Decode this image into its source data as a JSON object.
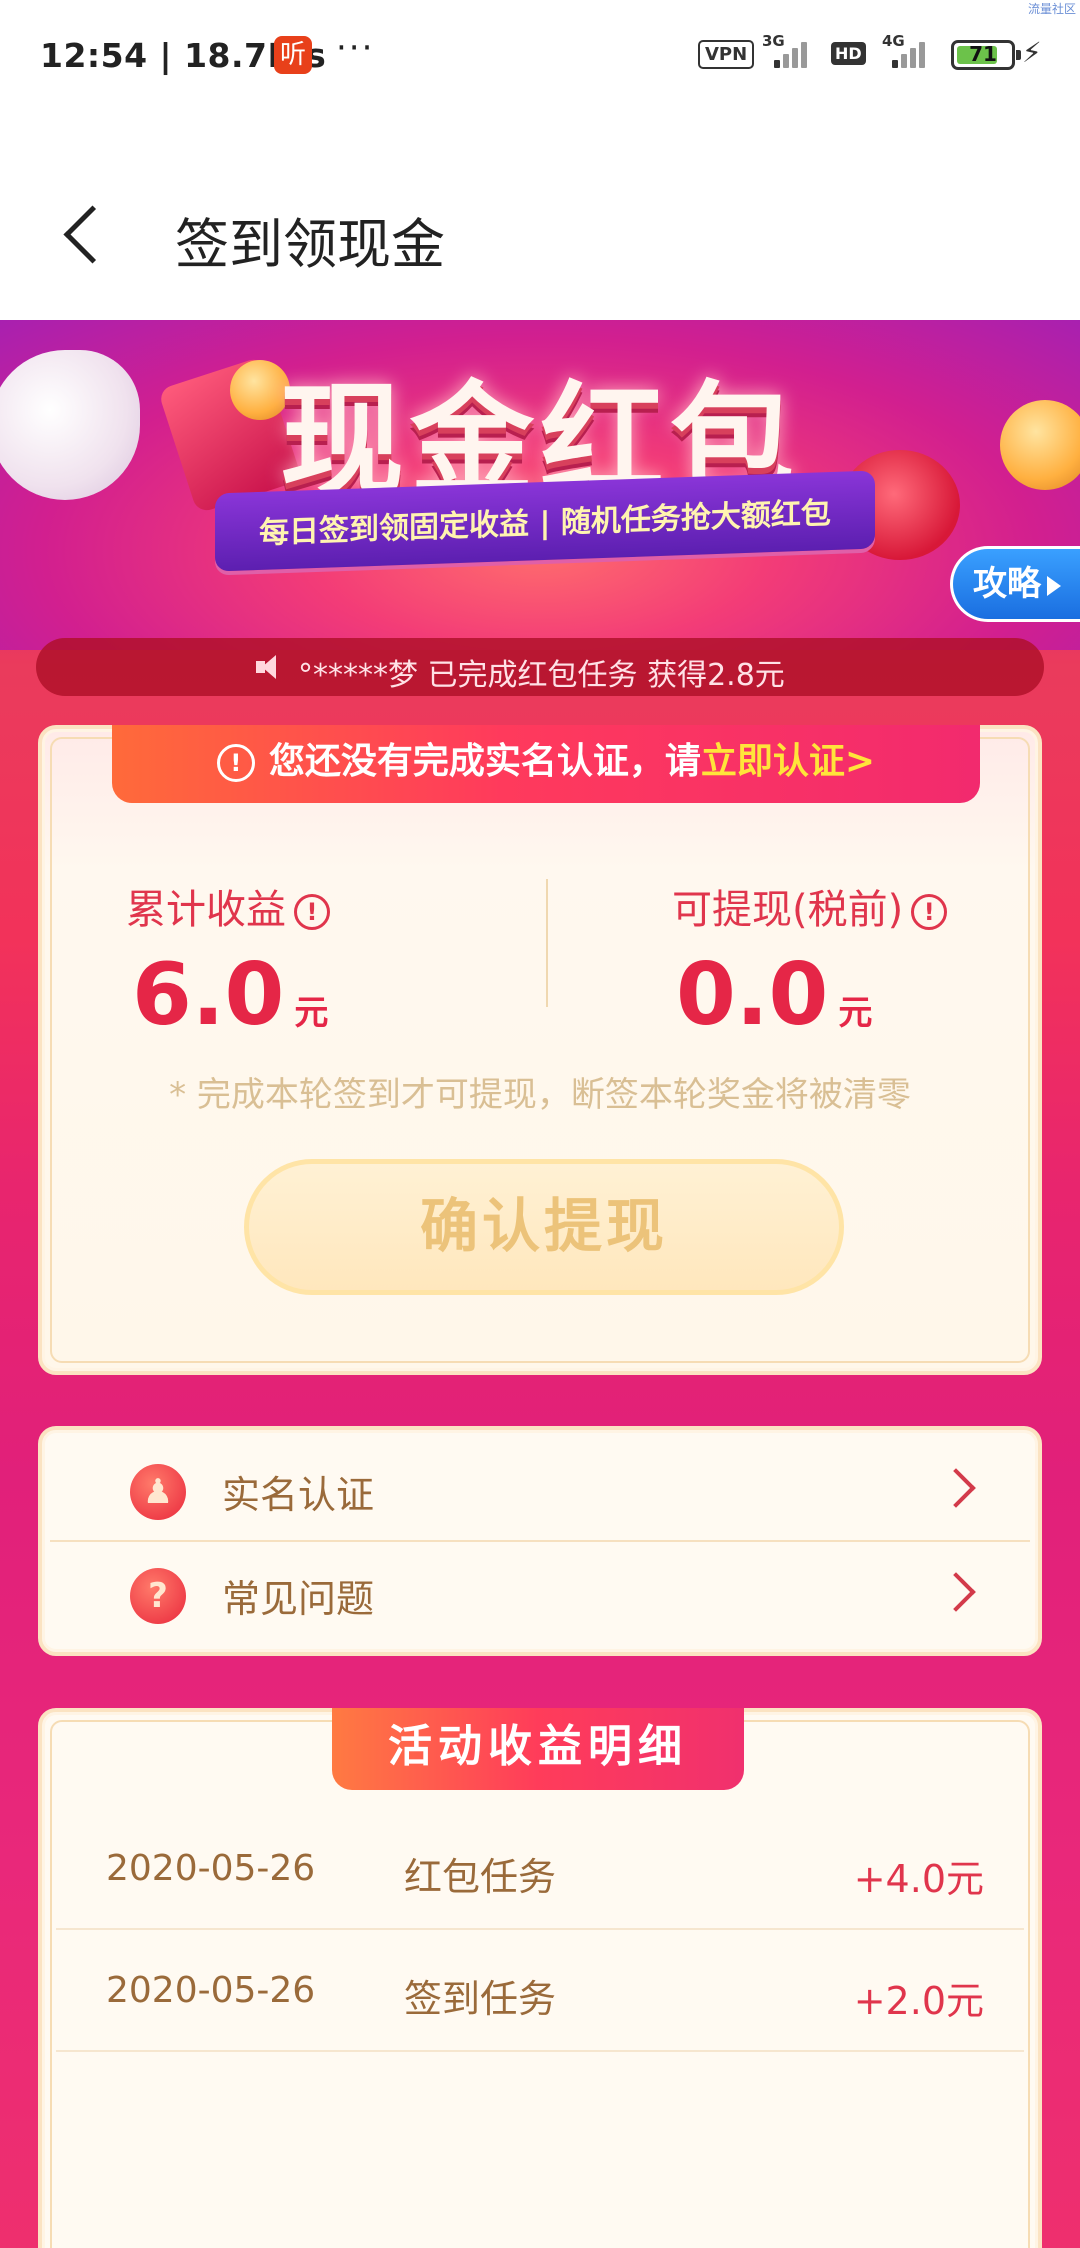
{
  "status_bar": {
    "time_speed": "12:54 | 18.7K/s",
    "app_icon": "听",
    "more": "···",
    "vpn": "VPN",
    "network1": "3G",
    "hd": "HD",
    "network2": "4G",
    "battery": "71",
    "watermark": "流量社区"
  },
  "header": {
    "title": "签到领现金"
  },
  "banner": {
    "main_title": "现金红包",
    "ribbon_text": "每日签到领固定收益 | 随机任务抢大额红包",
    "strategy_button": "攻略"
  },
  "marquee": {
    "text": "°*****梦 已完成红包任务 获得2.8元"
  },
  "earnings": {
    "notice_text": "您还没有完成实名认证，请",
    "notice_link": "立即认证>",
    "total_label": "累计收益",
    "total_value": "6.0",
    "total_unit": "元",
    "withdrawable_label": "可提现(税前)",
    "withdrawable_value": "0.0",
    "withdrawable_unit": "元",
    "tip": "* 完成本轮签到才可提现，断签本轮奖金将被清零",
    "withdraw_button": "确认提现"
  },
  "menu": {
    "items": [
      {
        "label": "实名认证",
        "icon": "identity-stamp-icon"
      },
      {
        "label": "常见问题",
        "icon": "question-icon"
      }
    ]
  },
  "records": {
    "title": "活动收益明细",
    "rows": [
      {
        "date": "2020-05-26",
        "type": "红包任务",
        "amount": "+4.0元"
      },
      {
        "date": "2020-05-26",
        "type": "签到任务",
        "amount": "+2.0元"
      }
    ]
  },
  "colors": {
    "accent_red": "#e52647",
    "page_pink": "#e1207a",
    "notice_gradient_start": "#ff6a3a",
    "strategy_blue": "#1a6ee0"
  }
}
